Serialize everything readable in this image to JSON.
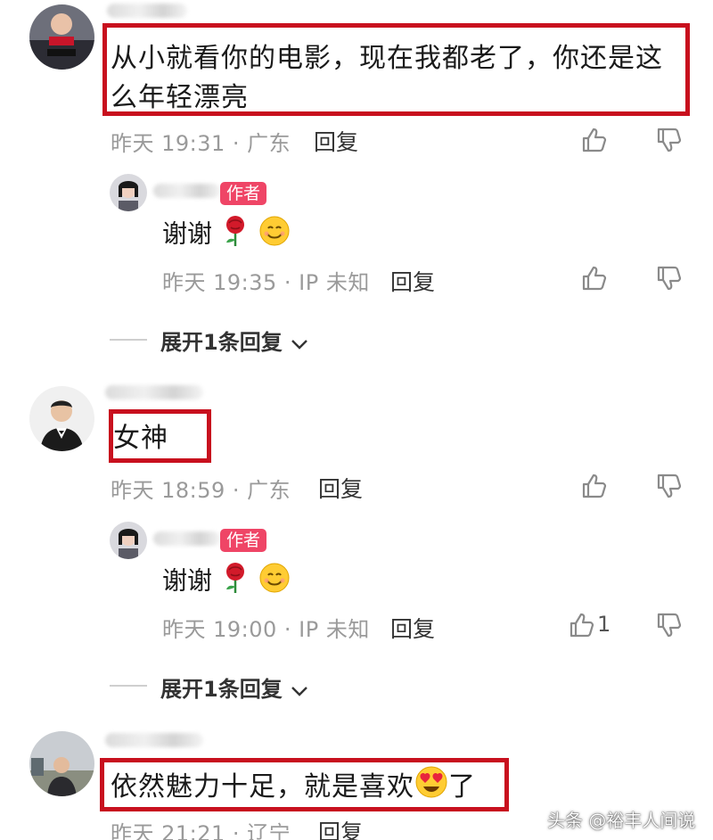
{
  "comments": [
    {
      "text": "从小就看你的电影，现在我都老了，你还是这么年轻漂亮",
      "meta": "昨天 19:31 · 广东",
      "reply_label": "回复",
      "reply": {
        "author_badge": "作者",
        "text": "谢谢",
        "meta": "昨天 19:35 · IP 未知",
        "reply_label": "回复"
      },
      "expand_label": "展开1条回复"
    },
    {
      "text": "女神",
      "meta": "昨天 18:59 · 广东",
      "reply_label": "回复",
      "reply": {
        "author_badge": "作者",
        "text": "谢谢",
        "meta": "昨天 19:00 · IP 未知",
        "reply_label": "回复",
        "like_count": "1"
      },
      "expand_label": "展开1条回复"
    },
    {
      "text_before": "依然魅力十足，就是喜欢",
      "text_after": "了",
      "meta": "昨天 21:21 · 辽宁",
      "reply_label": "回复"
    }
  ],
  "watermark": "头条 @裕丰人间说",
  "colors": {
    "highlight_box": "#c8101e",
    "author_badge": "#ef4566",
    "meta_text": "#9a9a9a"
  },
  "icons": [
    "thumb-up-icon",
    "thumb-down-icon",
    "rose-emoji",
    "smile-emoji",
    "heart-eyes-emoji",
    "chevron-down-icon"
  ]
}
